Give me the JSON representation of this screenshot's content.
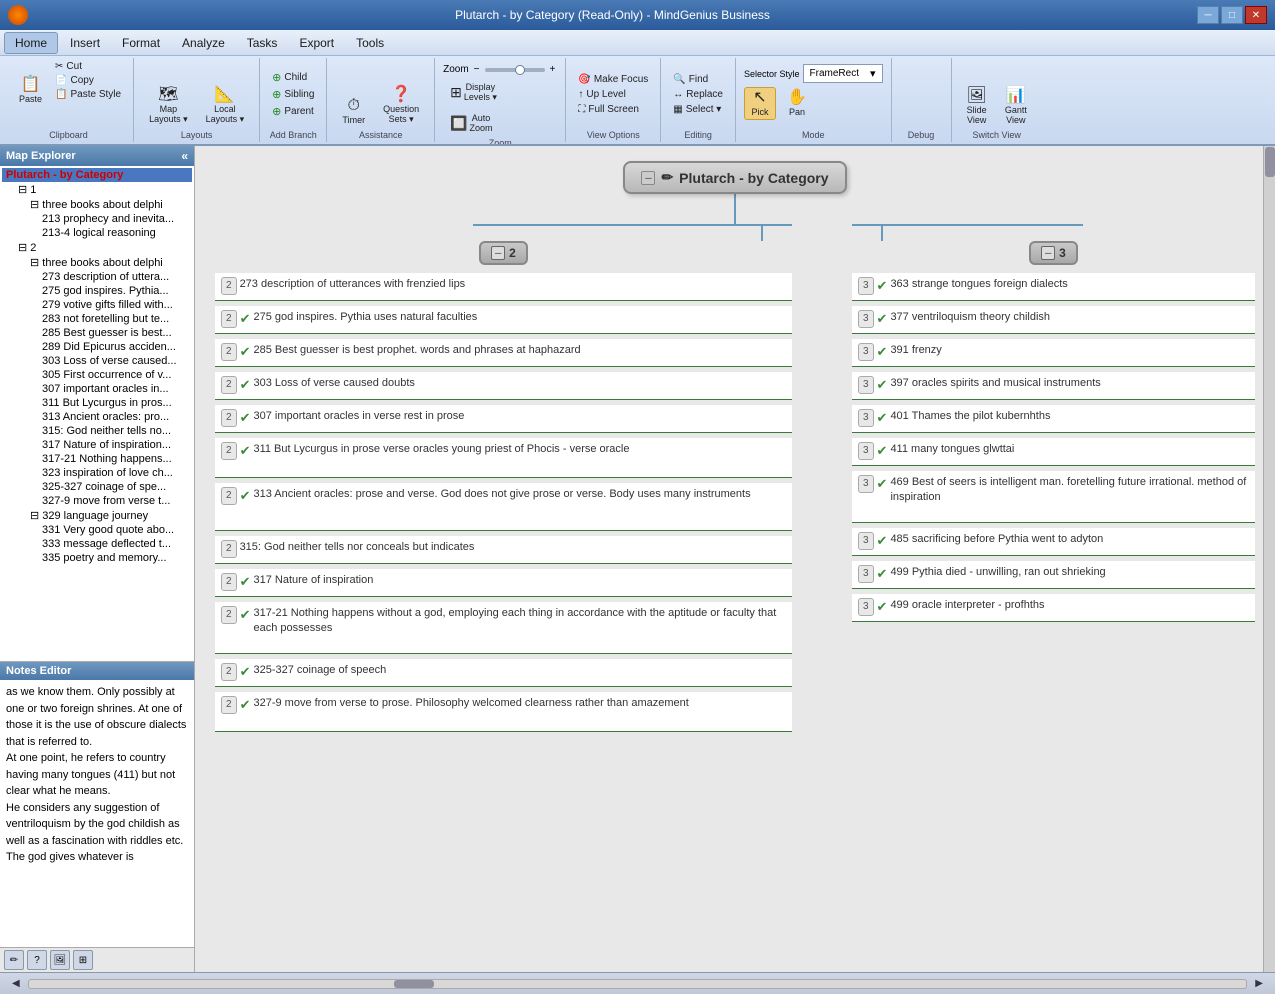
{
  "titleBar": {
    "title": "Plutarch - by Category (Read-Only) - MindGenius Business",
    "winBtns": [
      "─",
      "□",
      "✕"
    ]
  },
  "menuBar": {
    "items": [
      "Home",
      "Insert",
      "Format",
      "Analyze",
      "Tasks",
      "Export",
      "Tools"
    ]
  },
  "ribbon": {
    "groups": [
      {
        "label": "Clipboard",
        "buttons": [
          "Cut",
          "Copy",
          "Paste Style",
          "Paste"
        ]
      },
      {
        "label": "Layouts",
        "buttons": [
          "Map Layouts",
          "Local Layouts"
        ]
      },
      {
        "label": "Add Branch",
        "buttons": [
          "Child",
          "Sibling",
          "Parent"
        ]
      },
      {
        "label": "Assistance",
        "buttons": [
          "Timer",
          "Question Sets"
        ]
      },
      {
        "label": "Zoom",
        "buttons": [
          "Zoom",
          "Auto Zoom"
        ],
        "display_levels": "Display Levels"
      },
      {
        "label": "View Options",
        "buttons": [
          "Make Focus",
          "Up Level",
          "Full Screen"
        ]
      },
      {
        "label": "Editing",
        "buttons": [
          "Find",
          "Replace",
          "Select"
        ]
      },
      {
        "label": "Mode",
        "buttons": [
          "Pick",
          "Pan"
        ],
        "selector_style": "FrameRect"
      },
      {
        "label": "Debug",
        "buttons": []
      },
      {
        "label": "Switch View",
        "buttons": [
          "Slide View",
          "Gantt View"
        ]
      }
    ]
  },
  "mapExplorer": {
    "title": "Map Explorer",
    "tree": [
      {
        "label": "Plutarch - by Category",
        "level": 0,
        "selected": true
      },
      {
        "label": "1",
        "level": 1
      },
      {
        "label": "three books about delphi",
        "level": 2
      },
      {
        "label": "213 prophecy and inevita...",
        "level": 3
      },
      {
        "label": "213-4 logical reasoning",
        "level": 3
      },
      {
        "label": "2",
        "level": 1
      },
      {
        "label": "three books about delphi",
        "level": 2
      },
      {
        "label": "273 description of uttera...",
        "level": 3
      },
      {
        "label": "275 god inspires. Pythia...",
        "level": 3
      },
      {
        "label": "279 votive gifts filled with...",
        "level": 3
      },
      {
        "label": "283 not foretelling but te...",
        "level": 3
      },
      {
        "label": "285 Best guesser is best...",
        "level": 3
      },
      {
        "label": "289 Did Epicurus acciden...",
        "level": 3
      },
      {
        "label": "303 Loss of verse caused...",
        "level": 3
      },
      {
        "label": "305 First occurrence of v...",
        "level": 3
      },
      {
        "label": "307 important oracles in...",
        "level": 3
      },
      {
        "label": "311 But Lycurgus in pros...",
        "level": 3
      },
      {
        "label": "313 Ancient oracles: pro...",
        "level": 3
      },
      {
        "label": "315: God neither tells no...",
        "level": 3
      },
      {
        "label": "317 Nature of inspiration...",
        "level": 3
      },
      {
        "label": "317-21 Nothing happens...",
        "level": 3
      },
      {
        "label": "323 inspiration of love ch...",
        "level": 3
      },
      {
        "label": "325-327 coinage of spe...",
        "level": 3
      },
      {
        "label": "327-9 move from verse t...",
        "level": 3
      },
      {
        "label": "329 language journey",
        "level": 2
      },
      {
        "label": "331 Very good quote abo...",
        "level": 3
      },
      {
        "label": "333 message deflected t...",
        "level": 3
      },
      {
        "label": "335 poetry and memory...",
        "level": 3
      }
    ]
  },
  "notesEditor": {
    "title": "Notes Editor",
    "content": "as we know them. Only possibly at one or two foreign shrines. At one of those it is the use of obscure dialects that is referred to.\nAt one point, he refers to country having many tongues (411) but not clear what he means.\nHe considers any suggestion of ventriloquism by the god childish as well as a fascination with riddles etc.\nThe god gives whatever is"
  },
  "rootNode": {
    "label": "Plutarch - by Category"
  },
  "branches": [
    {
      "id": "branch2",
      "num": "2",
      "items": [
        {
          "badge": "2",
          "check": true,
          "text": "273 description of utterances with frenzied lips"
        },
        {
          "badge": "2",
          "check": true,
          "text": "275 god inspires. Pythia uses natural faculties"
        },
        {
          "badge": "2",
          "check": true,
          "text": "285 Best guesser is best prophet. words and phrases at haphazard"
        },
        {
          "badge": "2",
          "check": true,
          "text": "303 Loss of verse caused doubts"
        },
        {
          "badge": "2",
          "check": true,
          "text": "307 important oracles in verse rest in prose"
        },
        {
          "badge": "2",
          "check": false,
          "text": "311 But Lycurgus in prose verse oracles young priest of Phocis - verse oracle"
        },
        {
          "badge": "2",
          "check": true,
          "text": "313 Ancient oracles: prose and verse. God does not give prose or verse. Body uses many instruments"
        },
        {
          "badge": "2",
          "check": false,
          "text": "315: God neither tells nor conceals but indicates"
        },
        {
          "badge": "2",
          "check": true,
          "text": "317 Nature of inspiration"
        },
        {
          "badge": "2",
          "check": false,
          "text": "317-21 Nothing happens without a god, employing each thing in accordance with the aptitude or faculty that each possesses"
        },
        {
          "badge": "2",
          "check": true,
          "text": "325-327 coinage of speech"
        },
        {
          "badge": "2",
          "check": false,
          "text": "327-9 move from verse to prose. Philosophy welcomed clearness rather than amazement"
        }
      ]
    },
    {
      "id": "branch3",
      "num": "3",
      "items": [
        {
          "badge": "3",
          "check": true,
          "text": "363 strange tongues foreign dialects"
        },
        {
          "badge": "3",
          "check": true,
          "text": "377 ventriloquism theory childish"
        },
        {
          "badge": "3",
          "check": true,
          "text": "391 frenzy"
        },
        {
          "badge": "3",
          "check": true,
          "text": "397 oracles spirits and musical instruments"
        },
        {
          "badge": "3",
          "check": true,
          "text": "401 Thames the pilot kubernhths"
        },
        {
          "badge": "3",
          "check": true,
          "text": "411 many tongues glwttai"
        },
        {
          "badge": "3",
          "check": false,
          "text": "469 Best of seers is intelligent man. foretelling future irrational. method of inspiration"
        },
        {
          "badge": "3",
          "check": true,
          "text": "485 sacrificing before Pythia went to adyton"
        },
        {
          "badge": "3",
          "check": true,
          "text": "499 Pythia died - unwilling, ran out shrieking"
        },
        {
          "badge": "3",
          "check": true,
          "text": "499 oracle interpreter - profhths"
        }
      ]
    }
  ]
}
